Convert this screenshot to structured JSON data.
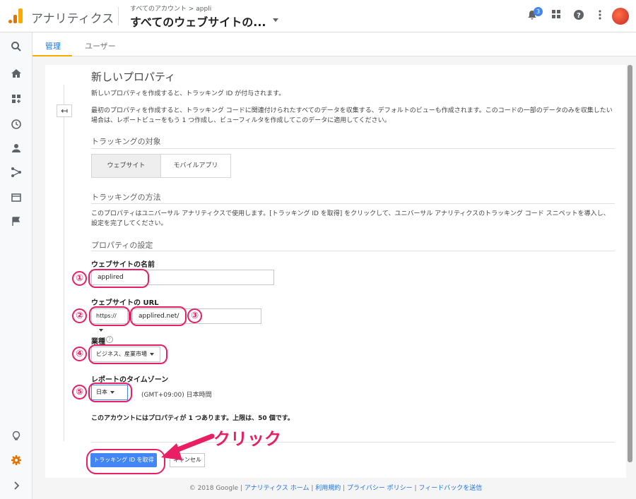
{
  "header": {
    "app_title": "アナリティクス",
    "breadcrumb": "すべてのアカウント > appli",
    "view_name": "すべてのウェブサイトの...",
    "notification_count": "3"
  },
  "tabs": [
    {
      "label": "管理"
    },
    {
      "label": "ユーザー"
    }
  ],
  "form": {
    "title": "新しいプロパティ",
    "intro": "新しいプロパティを作成すると、トラッキング ID が付与されます。",
    "intro2": "最初のプロパティを作成すると、トラッキング コードに関連付けられたすべてのデータを収集する、デフォルトのビューも作成されます。このコードの一部のデータのみを収集したい場合は、レポートビューをもう 1 つ作成し、ビューフィルタを作成してこのデータに適用してください。",
    "tracking_target_heading": "トラッキングの対象",
    "segment_website": "ウェブサイト",
    "segment_mobile": "モバイルアプリ",
    "tracking_method_heading": "トラッキングの方法",
    "tracking_method_text": "このプロパティはユニバーサル アナリティクスで使用します。[トラッキング ID を取得] をクリックして、ユニバーサル アナリティクスのトラッキング コード スニペットを導入し、設定を完了してください。",
    "property_settings_heading": "プロパティの設定",
    "site_name_label": "ウェブサイトの名前",
    "site_name_value": "applired",
    "site_url_label": "ウェブサイトの URL",
    "protocol_value": "https://",
    "url_value": "applired.net/",
    "industry_label": "業種",
    "industry_value": "ビジネス、産業市場",
    "timezone_label": "レポートのタイムゾーン",
    "timezone_country": "日本",
    "timezone_offset": "(GMT+09:00) 日本時間",
    "property_note": "このアカウントにはプロパティが 1 つあります。上限は、50 個です。",
    "get_id_button": "トラッキング ID を取得",
    "cancel_button": "キャンセル"
  },
  "annotations": {
    "n1": "①",
    "n2": "②",
    "n3": "③",
    "n4": "④",
    "n5": "⑤",
    "click": "クリック"
  },
  "footer": {
    "copyright": "© 2018 Google",
    "link1": "アナリティクス ホーム",
    "link2": "利用規約",
    "link3": "プライバシー ポリシー",
    "link4": "フィードバックを送信"
  },
  "colors": {
    "accent": "#e91e63",
    "primary": "#4285f4",
    "brand": "#f9ab00"
  }
}
